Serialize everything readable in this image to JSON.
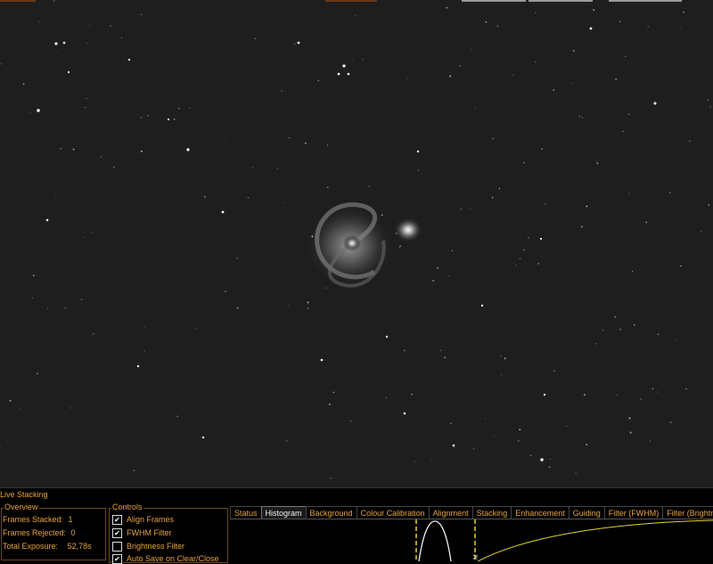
{
  "panel": {
    "title": "Live Stacking",
    "overview": {
      "title": "Overview",
      "frames_stacked_label": "Frames Stacked:",
      "frames_stacked_value": "1",
      "frames_rejected_label": "Frames Rejected:",
      "frames_rejected_value": "0",
      "total_exposure_label": "Total Exposure:",
      "total_exposure_value": "52,78s"
    },
    "controls": {
      "title": "Controls",
      "align_frames": {
        "label": "Align Frames",
        "checked": true
      },
      "fwhm_filter": {
        "label": "FWHM Filter",
        "checked": true
      },
      "brightness_filter": {
        "label": "Brightness Filter",
        "checked": false
      },
      "auto_save": {
        "label": "Auto Save on Clear/Close",
        "checked": true
      }
    },
    "tabs": [
      "Status",
      "Histogram",
      "Background",
      "Colour Calibration",
      "Alignment",
      "Stacking",
      "Enhancement",
      "Guiding",
      "Filter (FWHM)",
      "Filter (Brightness)"
    ],
    "active_tab": "Histogram"
  },
  "colors": {
    "accent": "#e8a33a",
    "sky": "#1e1e1e",
    "histogram_marker": "#e6d22a"
  }
}
